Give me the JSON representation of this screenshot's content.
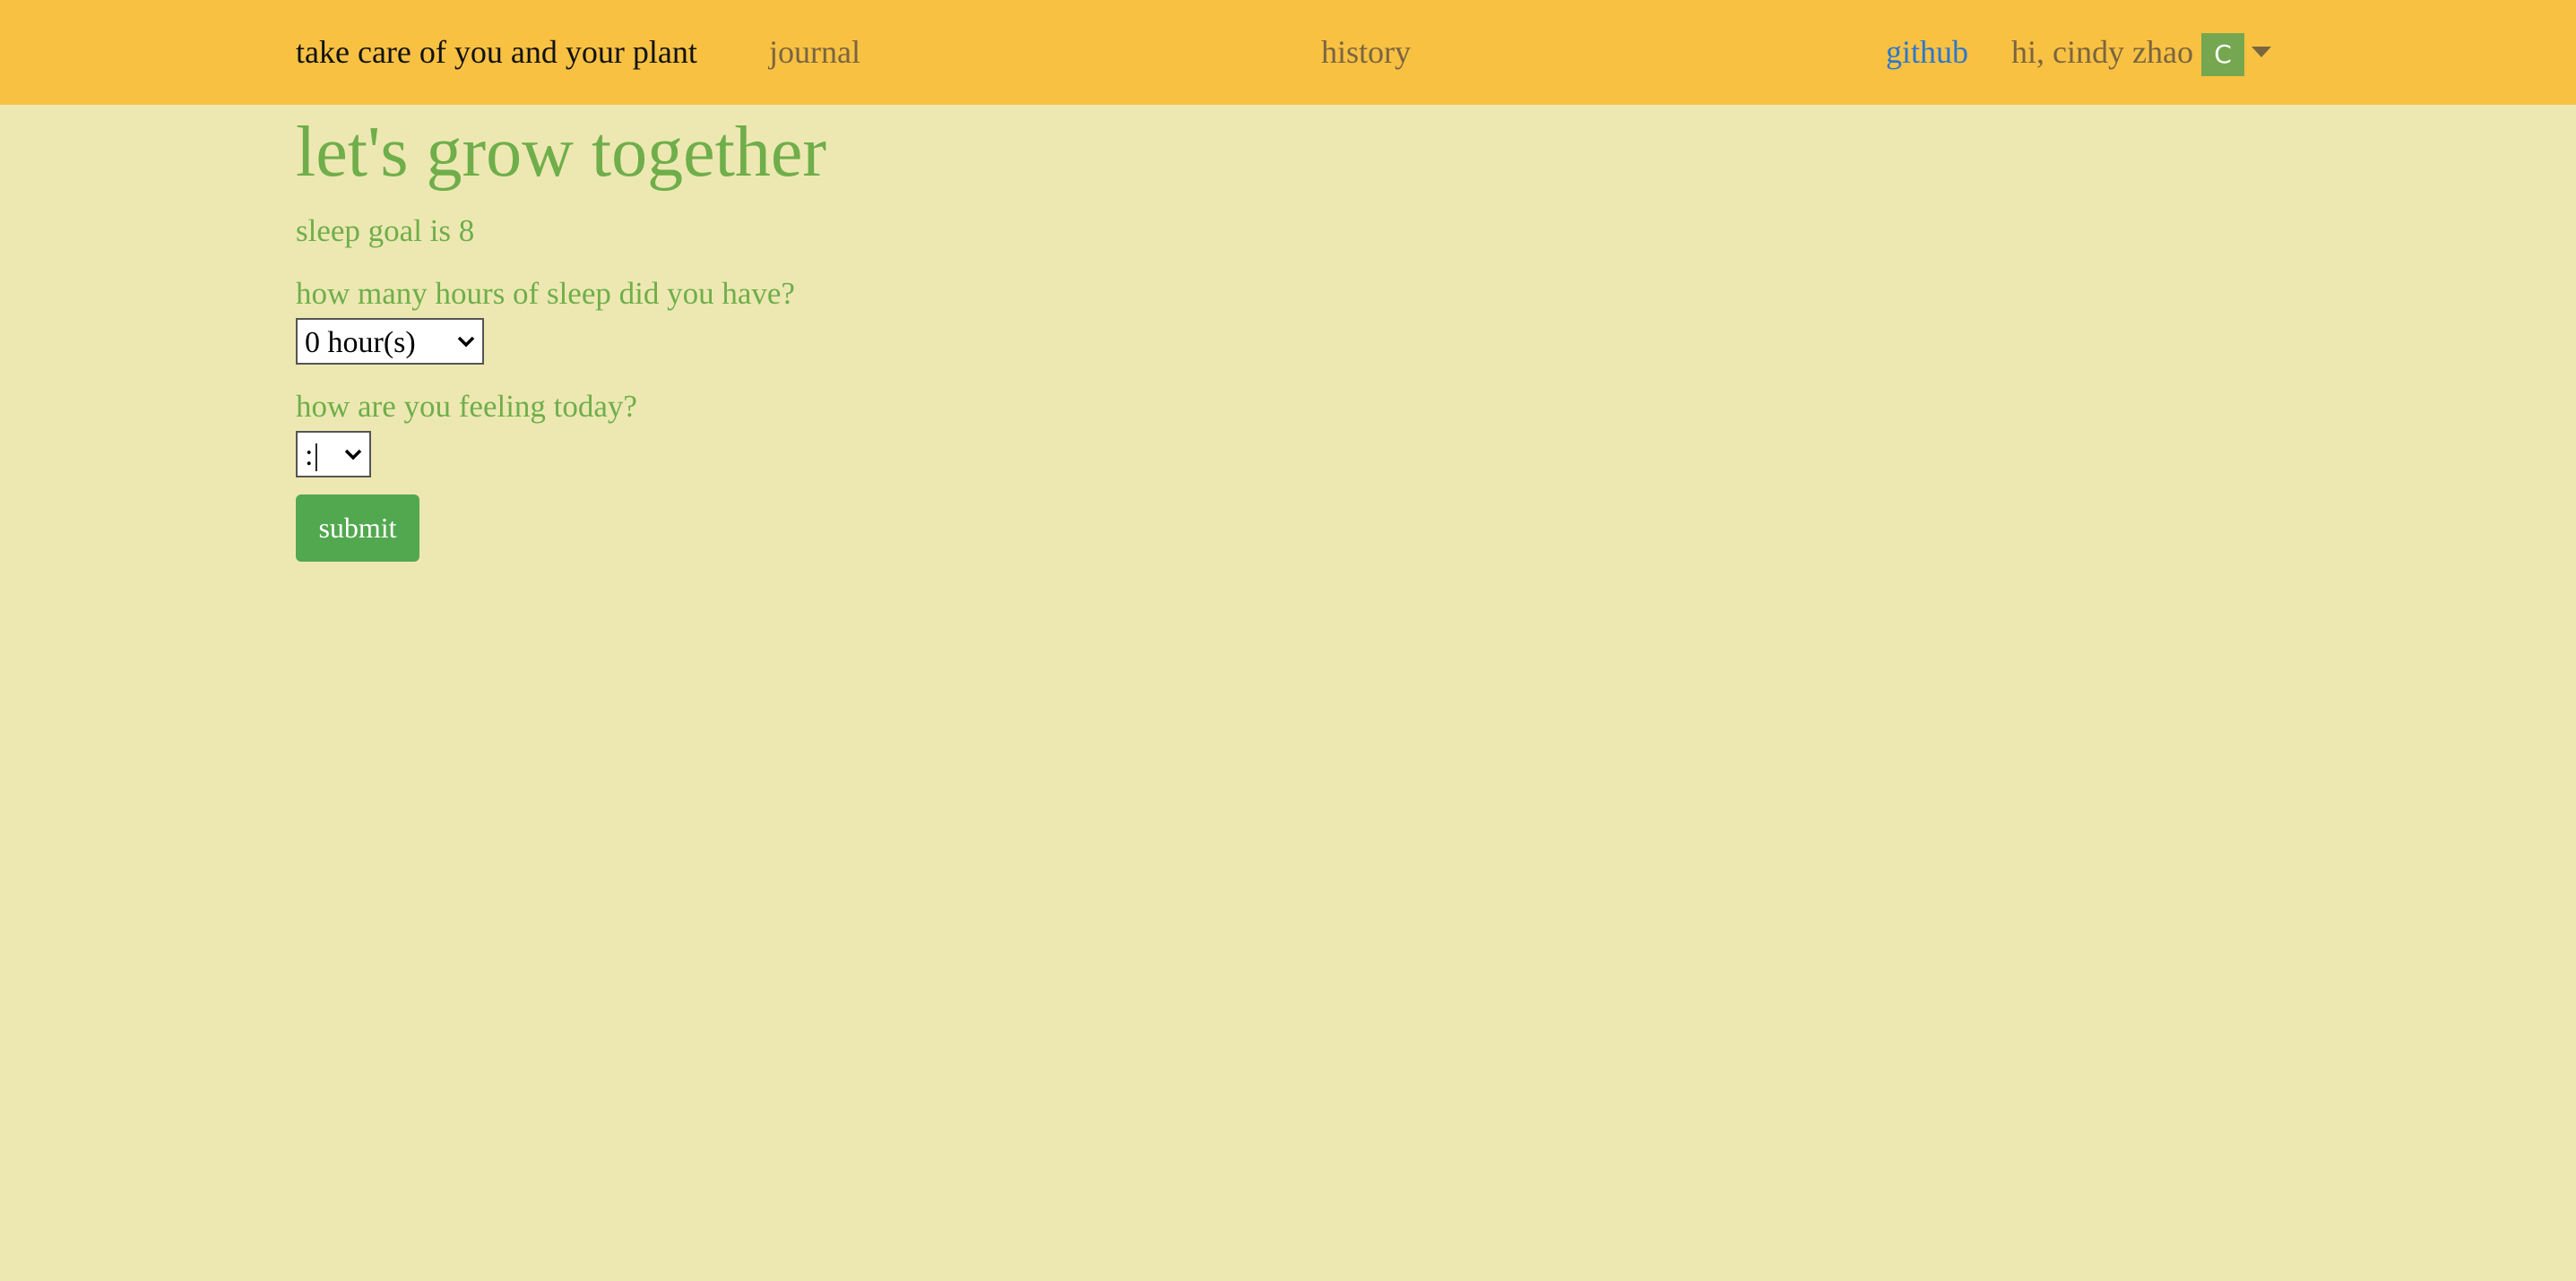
{
  "navbar": {
    "brand": "take care of you and your plant",
    "links": {
      "journal": "journal",
      "history": "history",
      "github": "github"
    },
    "greeting": "hi, cindy zhao",
    "avatar_initial": "C",
    "background_color": "#f8c142"
  },
  "main": {
    "heading": "let's grow together",
    "sleep_goal_text": "sleep goal is 8",
    "sleep_question": "how many hours of sleep did you have?",
    "sleep_select_value": "0 hour(s)",
    "mood_question": "how are you feeling today?",
    "mood_select_value": ":|",
    "submit_label": "submit"
  },
  "colors": {
    "page_background": "#ede8b2",
    "accent_green": "#6fae4a",
    "button_green": "#52a84f",
    "link_blue": "#2f78c9"
  }
}
